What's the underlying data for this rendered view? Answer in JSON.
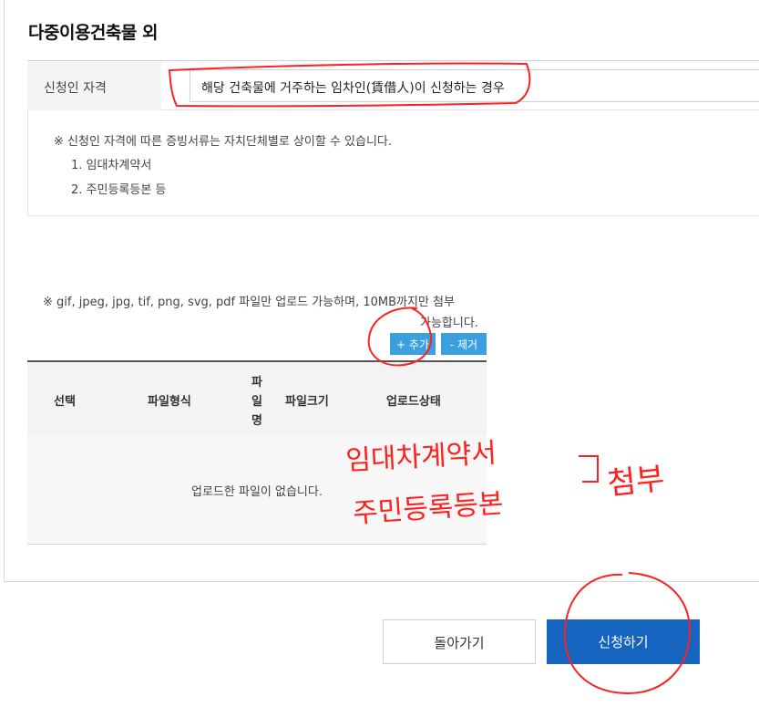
{
  "section": {
    "title": "다중이용건축물 외"
  },
  "applicant": {
    "label": "신청인 자격",
    "selected_value": "해당 건축물에 거주하는 임차인(賃借人)이 신청하는 경우"
  },
  "notice": {
    "intro": "※ 신청인 자격에 따른 증빙서류는 자치단체별로 상이할 수 있습니다.",
    "items": [
      "1. 임대차계약서",
      "2. 주민등록등본 등"
    ]
  },
  "upload": {
    "note_line1": "※ gif, jpeg, jpg, tif, png, svg, pdf 파일만 업로드 가능하며, 10MB까지만 첨부",
    "note_line2": "가능합니다.",
    "add_label": "+ 추가",
    "remove_label": "- 제거"
  },
  "file_table": {
    "columns": [
      "선택",
      "파일형식",
      "파일명",
      "파일크기",
      "업로드상태"
    ],
    "filename_chars": [
      "파",
      "일",
      "명"
    ],
    "empty_message": "업로드한 파일이 없습니다."
  },
  "actions": {
    "back_label": "돌아가기",
    "apply_label": "신청하기"
  },
  "annotations": {
    "handwritten_line1": "임대차계약서",
    "handwritten_line2": "주민등록등본",
    "handwritten_attach": "첨부",
    "ink_color": "#ff2020"
  },
  "colors": {
    "primary": "#1565c0",
    "small_button": "#3c9fe0"
  }
}
